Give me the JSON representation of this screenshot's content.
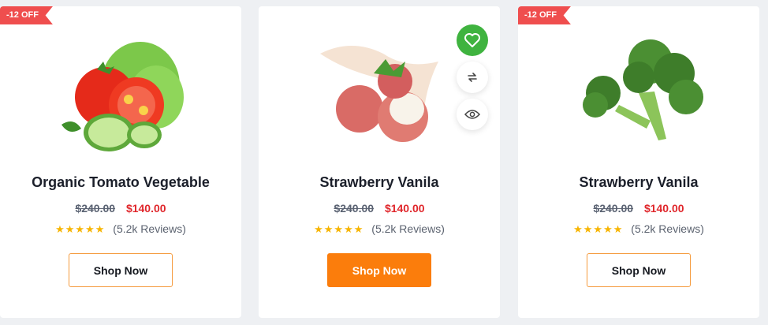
{
  "products": [
    {
      "badge": "-12 OFF",
      "title": "Organic Tomato Vegetable",
      "old_price": "$240.00",
      "new_price": "$140.00",
      "stars": "★★★★★",
      "reviews": "(5.2k Reviews)",
      "button": "Shop Now",
      "image_icon": "tomato-cucumber-icon"
    },
    {
      "title": "Strawberry Vanila",
      "old_price": "$240.00",
      "new_price": "$140.00",
      "stars": "★★★★★",
      "reviews": "(5.2k Reviews)",
      "button": "Shop Now",
      "image_icon": "lychee-icon",
      "actions": [
        "heart-icon",
        "swap-icon",
        "eye-icon"
      ]
    },
    {
      "badge": "-12 OFF",
      "title": "Strawberry Vanila",
      "old_price": "$240.00",
      "new_price": "$140.00",
      "stars": "★★★★★",
      "reviews": "(5.2k Reviews)",
      "button": "Shop Now",
      "image_icon": "broccoli-icon"
    }
  ],
  "colors": {
    "badge": "#ef4e4e",
    "price_new": "#e0272c",
    "star": "#f7b500",
    "button_active": "#fb7d0c",
    "button_border": "#f59a3c",
    "wishlist_active": "#3fb33f"
  }
}
